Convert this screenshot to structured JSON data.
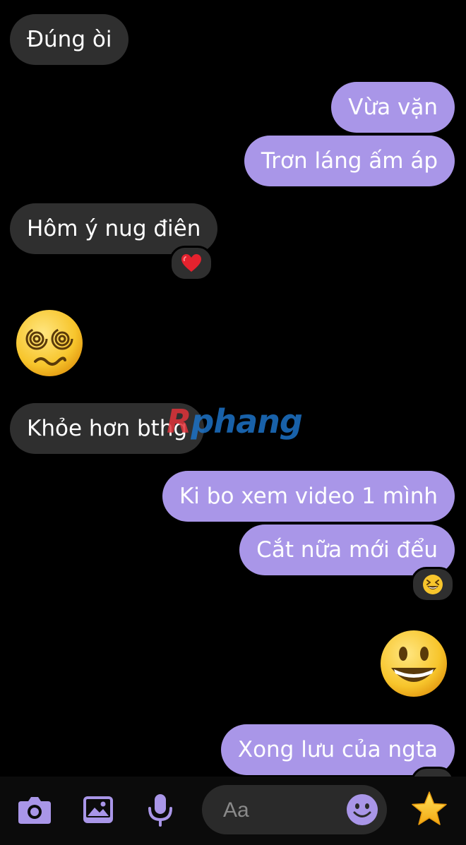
{
  "messages": {
    "m1": "Đúng òi",
    "m2": "Vừa vặn",
    "m3": "Trơn láng ấm áp",
    "m4": "Hôm ý nug điên",
    "m5": "Khỏe hơn bthg",
    "m6": "Ki bo xem video 1 mình",
    "m7": "Cắt nữa mới đểu",
    "m8": "Xong lưu của ngta"
  },
  "reactions": {
    "m4": "heart-emoji",
    "m7": "grinning-squinting-emoji"
  },
  "stickers": [
    "dizzy-face-emoji",
    "grinning-face-emoji"
  ],
  "watermark": {
    "r": "R",
    "rest": "phang"
  },
  "composer": {
    "placeholder": "Aa",
    "icons": [
      "camera-icon",
      "gallery-icon",
      "microphone-icon",
      "emoji-icon",
      "star-icon"
    ]
  },
  "colors": {
    "outgoing_bubble": "#a996e8",
    "incoming_bubble": "#2f2f2f",
    "accent": "#a996e8",
    "background": "#000000"
  }
}
